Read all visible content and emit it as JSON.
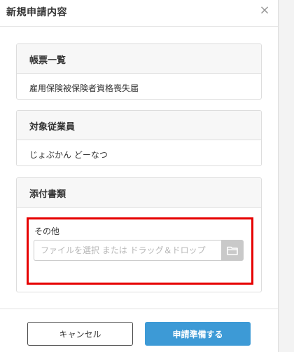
{
  "modal": {
    "title": "新規申請内容",
    "close_glyph": "×"
  },
  "sections": [
    {
      "heading": "帳票一覧",
      "value": "雇用保険被保険者資格喪失届"
    },
    {
      "heading": "対象従業員",
      "value": "じょぶかん どーなつ"
    },
    {
      "heading": "添付書類"
    }
  ],
  "attachment": {
    "label": "その他",
    "placeholder": "ファイルを選択 または ドラッグ＆ドロップ",
    "browse_icon": "folder-icon"
  },
  "footer": {
    "cancel_label": "キャンセル",
    "submit_label": "申請準備する"
  },
  "colors": {
    "primary": "#3d9ad6",
    "highlight": "#e60000",
    "folder_button": "#c9c9c9"
  }
}
